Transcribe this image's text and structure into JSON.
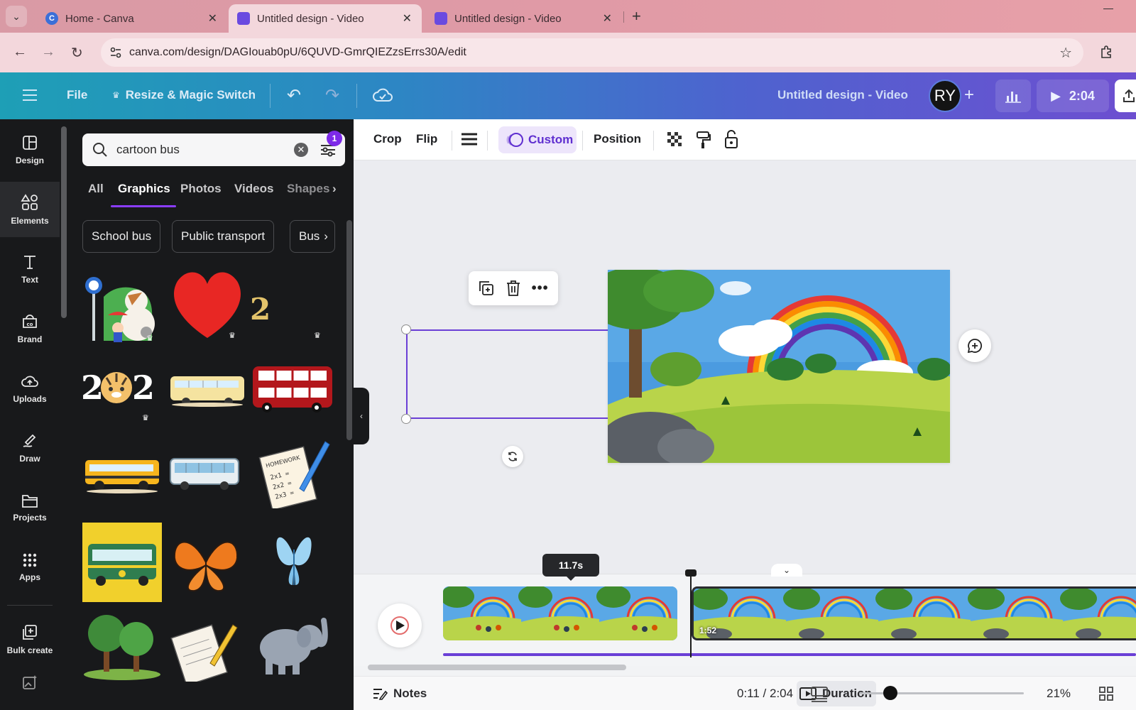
{
  "browser": {
    "tabs": [
      {
        "label": "Home - Canva",
        "close": "✕"
      },
      {
        "label": "Untitled design - Video",
        "close": "✕"
      },
      {
        "label": "Untitled design - Video",
        "close": "✕"
      }
    ],
    "new_tab": "+",
    "url": "canva.com/design/DAGIouab0pU/6QUVD-GmrQIEZzsErrs30A/edit"
  },
  "header": {
    "file_label": "File",
    "resize_label": "Resize & Magic Switch",
    "design_title": "Untitled design - Video",
    "avatar_initials": "RY",
    "play_time": "2:04"
  },
  "rail": [
    {
      "label": "Design",
      "icon": "design-icon"
    },
    {
      "label": "Elements",
      "icon": "elements-icon"
    },
    {
      "label": "Text",
      "icon": "text-icon"
    },
    {
      "label": "Brand",
      "icon": "brand-icon"
    },
    {
      "label": "Uploads",
      "icon": "uploads-icon"
    },
    {
      "label": "Draw",
      "icon": "draw-icon"
    },
    {
      "label": "Projects",
      "icon": "projects-icon"
    },
    {
      "label": "Apps",
      "icon": "apps-icon"
    },
    {
      "label": "Bulk create",
      "icon": "bulk-create-icon"
    }
  ],
  "panel": {
    "search_value": "cartoon bus",
    "filter_count": "1",
    "tabs": [
      "All",
      "Graphics",
      "Photos",
      "Videos",
      "Shapes"
    ],
    "active_tab": "Graphics",
    "chips": [
      "School bus",
      "Public transport",
      "Bus"
    ],
    "grid_items": [
      "bus-stop-dog-graphic",
      "red-heart-graphic",
      "number-two-graphic",
      "blank-graphic",
      "tiger-2022-graphic",
      "yellow-bus-graphic",
      "red-double-decker-bus-graphic",
      "school-bus-graphic",
      "city-bus-graphic",
      "homework-note-graphic",
      "green-bus-card-graphic",
      "monarch-butterfly-graphic",
      "blue-butterfly-graphic",
      "trees-graphic",
      "papers-pencil-graphic",
      "elephant-graphic"
    ],
    "homework_text": "HOMEWORK"
  },
  "toolbar": {
    "crop": "Crop",
    "flip": "Flip",
    "custom": "Custom",
    "position": "Position"
  },
  "timeline": {
    "tooltip_duration": "11.7s",
    "clip2_label": "1:52",
    "progress_fraction": 1.0
  },
  "footer": {
    "notes": "Notes",
    "duration": "Duration",
    "time": "0:11 / 2:04",
    "zoom": "21%",
    "zoom_fraction": 0.21
  },
  "colors": {
    "accent": "#7d2ae8",
    "selection": "#6a3fd6",
    "panel_bg": "#18191b"
  }
}
